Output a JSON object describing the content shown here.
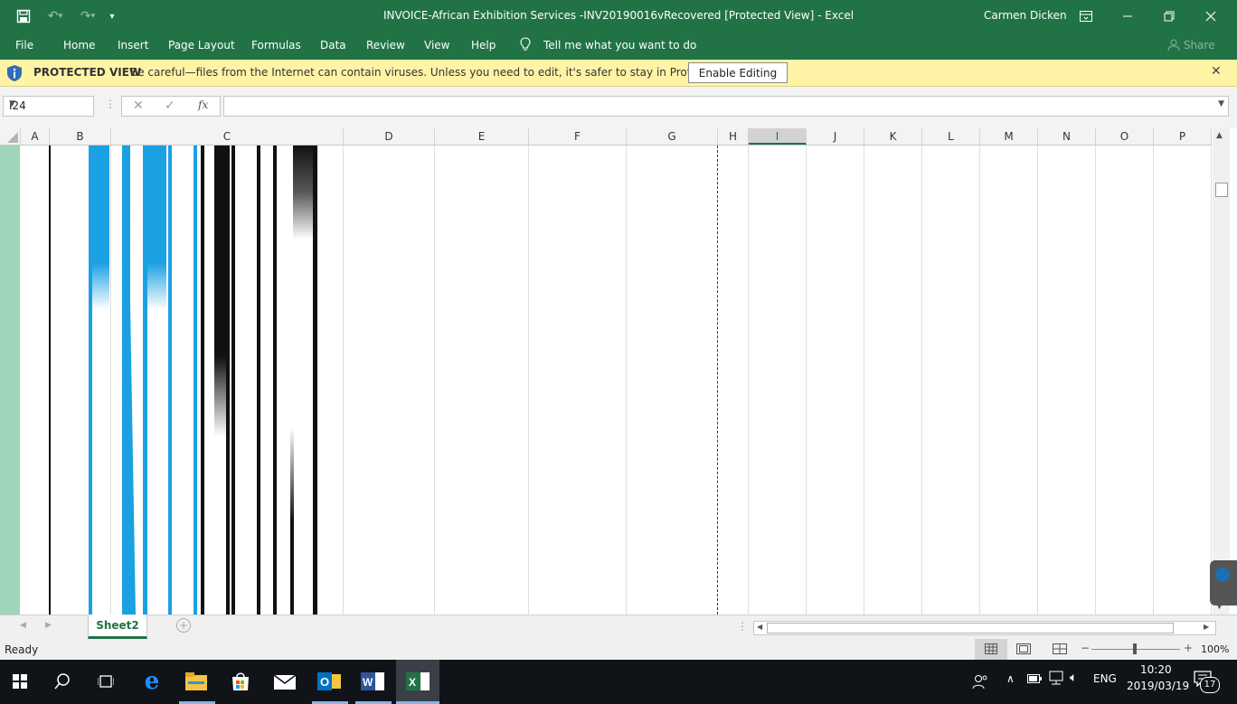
{
  "titlebar": {
    "title": "INVOICE-African Exhibition Services -INV20190016vRecovered  [Protected View]  -  Excel",
    "user": "Carmen Dicken"
  },
  "ribbon": {
    "tabs": [
      "File",
      "Home",
      "Insert",
      "Page Layout",
      "Formulas",
      "Data",
      "Review",
      "View",
      "Help"
    ],
    "tell_me": "Tell me what you want to do",
    "share": "Share"
  },
  "protected_view": {
    "title": "PROTECTED VIEW",
    "message": "Be careful—files from the Internet can contain viruses. Unless you need to edit, it's safer to stay in Protected View.",
    "enable_button": "Enable Editing"
  },
  "formula_bar": {
    "name_box": "I24",
    "fx": "fx",
    "formula": ""
  },
  "columns": [
    "A",
    "B",
    "C",
    "D",
    "E",
    "F",
    "G",
    "H",
    "I",
    "J",
    "K",
    "L",
    "M",
    "N",
    "O",
    "P"
  ],
  "selected_column": "I",
  "sheet_tabs": {
    "active": "Sheet2"
  },
  "status": {
    "ready": "Ready",
    "zoom": "100%"
  },
  "taskbar": {
    "lang": "ENG",
    "time": "10:20",
    "date": "2019/03/19",
    "notifications": "17"
  },
  "colors": {
    "excel_green": "#217346",
    "protected_yellow": "#fff4a6",
    "barcode_blue": "#1ba1e2"
  }
}
